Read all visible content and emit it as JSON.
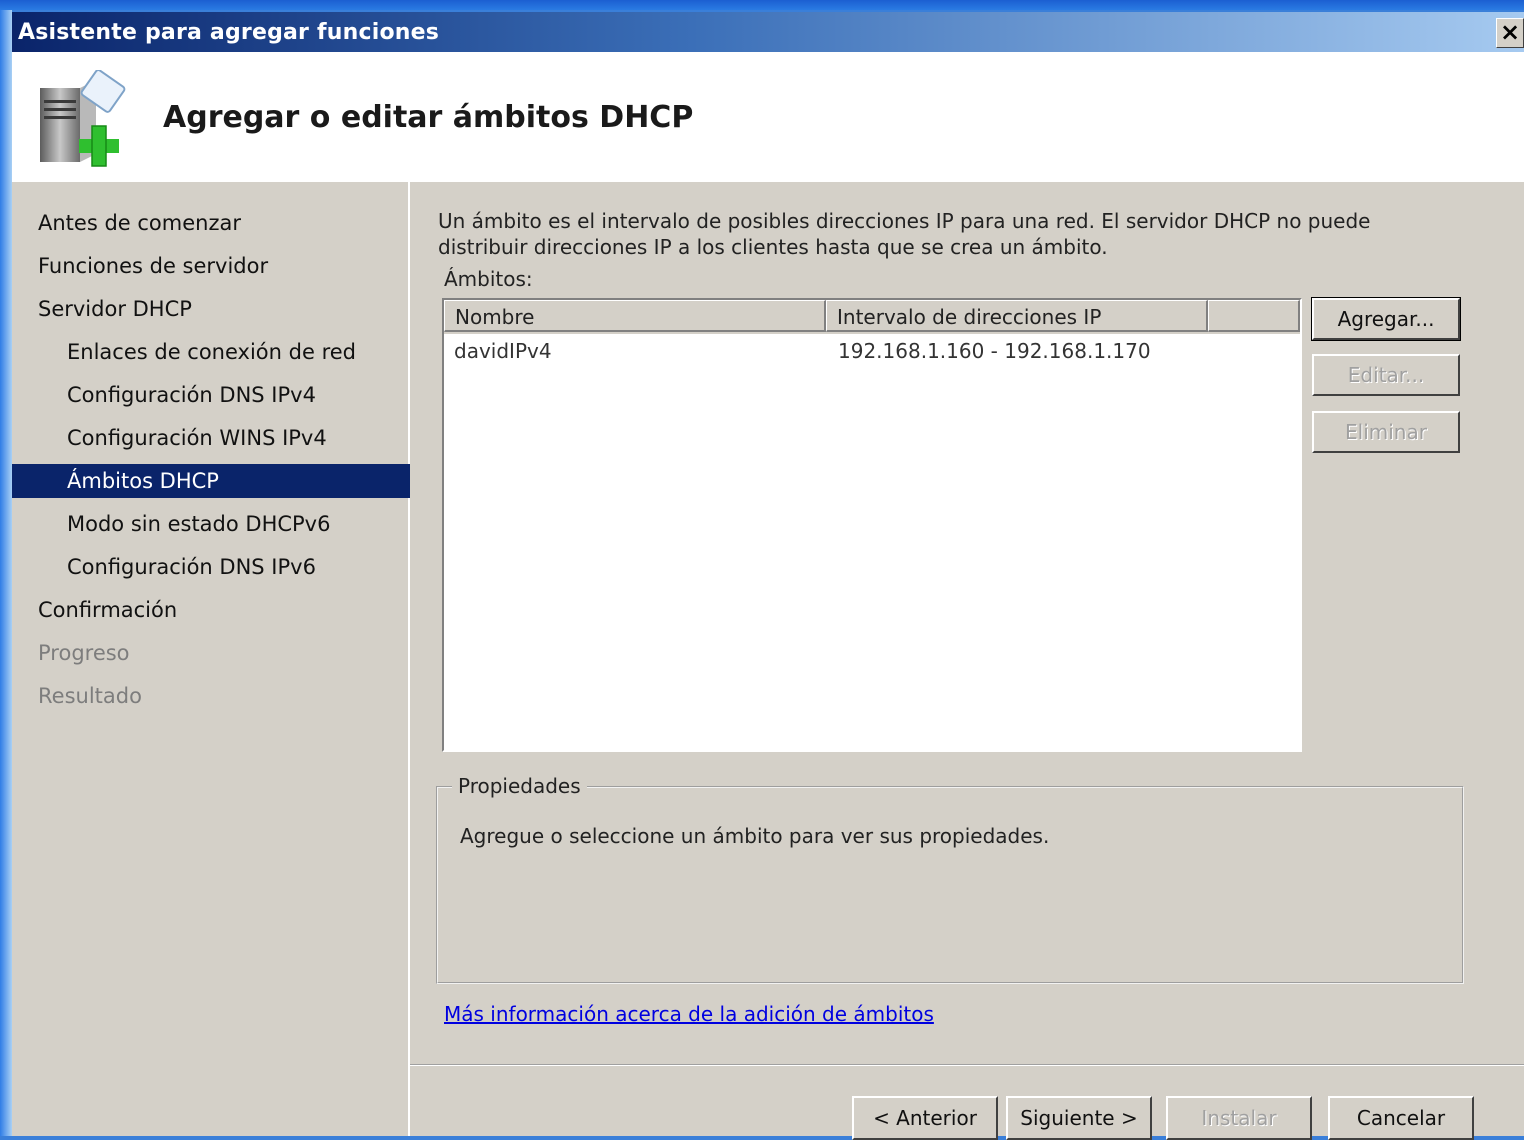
{
  "window": {
    "title": "Asistente para agregar funciones",
    "close_label": "×"
  },
  "header": {
    "title": "Agregar o editar ámbitos DHCP"
  },
  "nav": {
    "items": [
      {
        "label": "Antes de comenzar",
        "level": 0,
        "state": "normal"
      },
      {
        "label": "Funciones de servidor",
        "level": 0,
        "state": "normal"
      },
      {
        "label": "Servidor DHCP",
        "level": 0,
        "state": "normal"
      },
      {
        "label": "Enlaces de conexión de red",
        "level": 1,
        "state": "normal"
      },
      {
        "label": "Configuración DNS IPv4",
        "level": 1,
        "state": "normal"
      },
      {
        "label": "Configuración WINS IPv4",
        "level": 1,
        "state": "normal"
      },
      {
        "label": "Ámbitos DHCP",
        "level": 1,
        "state": "active"
      },
      {
        "label": "Modo sin estado DHCPv6",
        "level": 1,
        "state": "normal"
      },
      {
        "label": "Configuración DNS IPv6",
        "level": 1,
        "state": "normal"
      },
      {
        "label": "Confirmación",
        "level": 0,
        "state": "normal"
      },
      {
        "label": "Progreso",
        "level": 0,
        "state": "disabled"
      },
      {
        "label": "Resultado",
        "level": 0,
        "state": "disabled"
      }
    ]
  },
  "content": {
    "description": "Un ámbito es el intervalo de posibles direcciones IP para una red. El servidor DHCP no puede distribuir direcciones IP a los clientes hasta que se crea un ámbito.",
    "scopes_label": "Ámbitos:",
    "table": {
      "columns": [
        "Nombre",
        "Intervalo de direcciones IP",
        ""
      ],
      "rows": [
        {
          "name": "davidIPv4",
          "range": "192.168.1.160 - 192.168.1.170"
        }
      ]
    },
    "buttons": {
      "add": "Agregar...",
      "edit": "Editar...",
      "delete": "Eliminar"
    },
    "properties": {
      "legend": "Propiedades",
      "text": "Agregue o seleccione un ámbito para ver sus propiedades."
    },
    "more_info_link": "Más información acerca de la adición de ámbitos"
  },
  "footer": {
    "back": "< Anterior",
    "next": "Siguiente >",
    "install": "Instalar",
    "cancel": "Cancelar"
  }
}
